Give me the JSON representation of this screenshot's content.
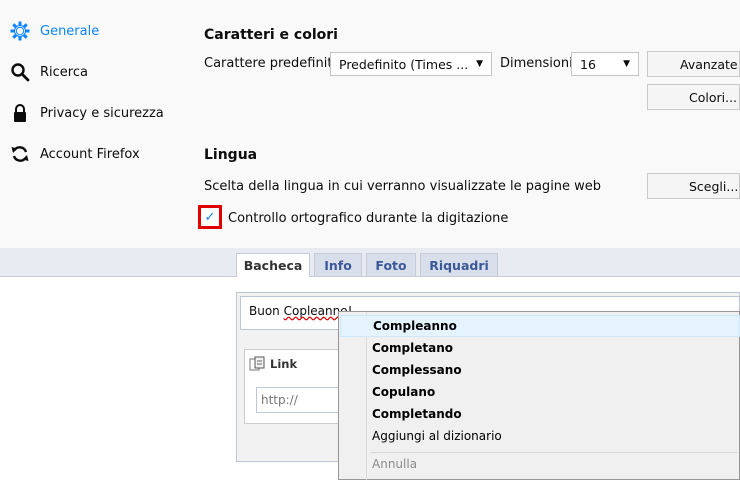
{
  "sidebar": {
    "items": [
      {
        "label": "Generale",
        "icon": "gear-icon",
        "active": true
      },
      {
        "label": "Ricerca",
        "icon": "search-icon"
      },
      {
        "label": "Privacy e sicurezza",
        "icon": "lock-icon"
      },
      {
        "label": "Account Firefox",
        "icon": "sync-icon"
      }
    ]
  },
  "fonts": {
    "title": "Caratteri e colori",
    "default_font_label": "Carattere predefinito",
    "default_font_value": "Predefinito (Times ...",
    "size_label": "Dimensioni",
    "size_value": "16",
    "advanced_button": "Avanzate...",
    "colors_button": "Colori..."
  },
  "language": {
    "title": "Lingua",
    "description": "Scelta della lingua in cui verranno visualizzate le pagine web",
    "choose_button": "Scegli...",
    "spellcheck_label": "Controllo ortografico durante la digitazione",
    "spellcheck_checked": true
  },
  "page": {
    "tabs": [
      {
        "label": "Bacheca",
        "active": true
      },
      {
        "label": "Info"
      },
      {
        "label": "Foto"
      },
      {
        "label": "Riquadri"
      }
    ],
    "composer_prefix": "Buon ",
    "composer_misspelled": "Copleanno!",
    "link_title": "Link",
    "url_placeholder": "http://"
  },
  "context_menu": {
    "suggestions": [
      "Compleanno",
      "Completano",
      "Complessano",
      "Copulano",
      "Completando"
    ],
    "add_to_dictionary": "Aggiungi al dizionario",
    "undo": "Annulla"
  },
  "colors": {
    "accent": "#0a84ff",
    "highlight_box": "#e00000",
    "fb_link": "#3b5998"
  }
}
